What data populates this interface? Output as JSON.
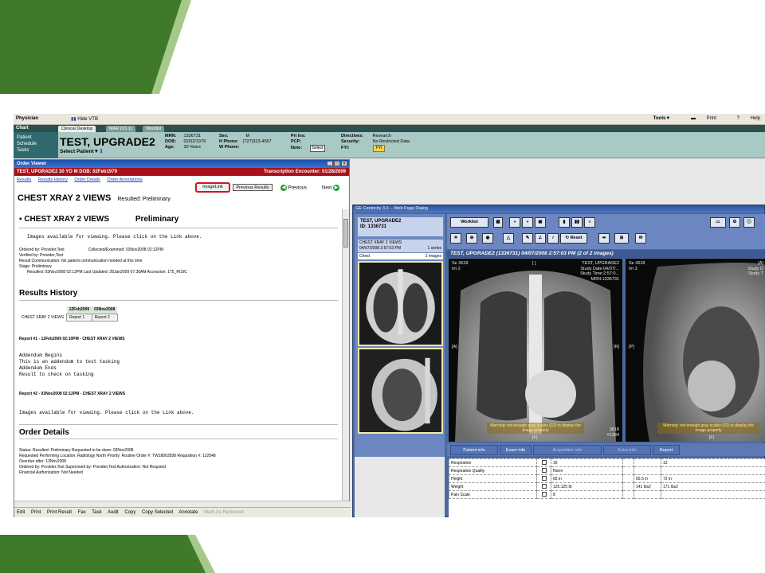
{
  "topbar": {
    "title": "Physician",
    "hide_vtb": "Hide VTB",
    "tools": "Tools▼",
    "print": "Print",
    "help": "Help"
  },
  "tabs": {
    "chart": "Chart",
    "items": [
      "Clinical Desktop",
      "MAR (V1.1)",
      "Worklist"
    ]
  },
  "sidenav": [
    "Patient",
    "Schedule",
    "Tasks"
  ],
  "patient": {
    "name": "TEST, UPGRADE2",
    "select_patient": "Select Patient▼",
    "mrn_label": "MRN:",
    "mrn": "1336731",
    "dob_label": "DOB:",
    "dob": "02/02/1979",
    "age_label": "Age:",
    "age": "30 Years",
    "sex_label": "Sex:",
    "sex": "M",
    "hphone_label": "H Phone:",
    "hphone": "(727)323-4567",
    "wphone_label": "W Phone:",
    "wphone": "",
    "priins_label": "Pri Ins:",
    "pcp_label": "PCP:",
    "note_label": "Note:",
    "note_btn": "Select",
    "directives_label": "Directives:",
    "directives": "Research",
    "security_label": "Security:",
    "security": "No Restricted Data",
    "fyi_label": "FYI:",
    "fyi_btn": "FYI"
  },
  "order_viewer": {
    "title": "Order Viewer",
    "red_bar": "TEST, UPGRADE2   30 YO   M DOB: 02Feb1979",
    "encounter": "Transcription Encounter: 01/28/2009",
    "links": [
      "Results",
      "Results History",
      "Order Details",
      "Order Annotations"
    ],
    "image_link": "ImageLink",
    "previous_results": "Previous Results",
    "previous": "Previous",
    "next": "Next",
    "heading": "CHEST XRAY 2 VIEWS",
    "resulted": "Resulted:  Preliminary",
    "result_title": "CHEST XRAY 2 VIEWS",
    "result_status": "Preliminary",
    "images_available": "Images available for viewing.  Please click on the Link above.",
    "ordered_by": "Ordered by:  Provider,Test",
    "collected": "Collected/Examined:  03Nov2008 02:12PM",
    "verified_by": "Verified by:  Provider,Test",
    "result_comm": "Result Communication:  No patient communication needed at this time",
    "stage": "Stage:  Preliminary",
    "resulted_line": "Resulted:  03Nov2008 02:12PM     Last Updated:  28Jan2009 07:30AM     Accession:  175_RISIC",
    "results_history_heading": "Results History",
    "rh_dates": [
      "12Feb2009",
      "03Nov2008"
    ],
    "rh_row_label": "CHEST XRAY 2 VIEWS",
    "rh_reports": [
      "Report 1",
      "Report 2"
    ],
    "report1_title": "Report #1 - 12Feb2009 02:10PM - CHEST XRAY 2 VIEWS",
    "report1_lines": [
      "Addendum Begins",
      "This is an addendum to test tasking",
      "Addendum Ends",
      "Result to check on tasking"
    ],
    "report2_title": "Report #2 - 03Nov2008 02:12PM - CHEST XRAY 2 VIEWS",
    "report2_line": "Images available for viewing.  Please click on the Link above.",
    "order_details_heading": "Order Details",
    "od_status": "Status:  Resulted: Preliminary       Requested to be done:  03Nov2008",
    "od_location": "Requested Performing Location:  Radiology North     Priority:  Routine     Order #:  TW18003598     Requisition #:  122548",
    "od_overdue": "Overdue after:  13Nov2008",
    "od_ordered": "Ordered by:  Provider,Test          Supervised by:  Provider,Test          Authorization:  Not Required",
    "od_financial": "Financial Authorization:  Not Needed",
    "footer": [
      "Edit",
      "Print",
      "Print Result",
      "Fax",
      "Task",
      "Audit",
      "Copy",
      "Copy Selected",
      "Annotate"
    ],
    "footer_disabled": "Mark As Reviewed"
  },
  "ge_viewer": {
    "title": "GE Centricity 3.0 -- Web Page Dialog",
    "patient": "TEST, UPGRADE2",
    "id": "ID: 1336731",
    "study_name": "CHEST XRAY 2 VIEWS",
    "study_date": "04/07/2008 2:57:03 PM",
    "series": "1 series",
    "chest": "Chest",
    "images": "2 images",
    "worklist": "Worklist",
    "reset": "Reset",
    "caption": "TEST, UPGRADE2 (1336731) 04/07/2008 2:57:03 PM (2 of 2 images)",
    "img1_se": "Se 3618",
    "img1_im": "Im 2",
    "img1_pat": "TEST, UPGRADE2",
    "img1_study": "Study Date:04/07/...",
    "img1_time": "Study Time:2:57:0...",
    "img1_mrn": "MRN:1336731",
    "img1_a": "[A]",
    "img1_r": "[R]",
    "img1_f": "[F]",
    "img1_num1": "3818",
    "img1_num2": "Y1384",
    "img2_se": "Se 3618",
    "img2_im": "Im 3",
    "img2_study": "Study D",
    "img2_time": "Study T",
    "img2_p": "[P]",
    "img2_a": "[A]",
    "img2_f": "[F]",
    "warning": "Warning: not enough gray scales (32) to display the image properly",
    "tabs": [
      "Patient info",
      "Exam info",
      "Acquisition info",
      "Extra info",
      "Report"
    ],
    "vitals": [
      [
        "Respiration",
        "16",
        "",
        "12"
      ],
      [
        "Respiration Quality",
        "Norm",
        "",
        ""
      ],
      [
        "Height",
        "65 in",
        "65.5 in",
        "72 in"
      ],
      [
        "Weight",
        "125.125 lb",
        "141 lbs2",
        "171 lbs2"
      ],
      [
        "Pain Scale",
        "8",
        "",
        ""
      ]
    ]
  }
}
